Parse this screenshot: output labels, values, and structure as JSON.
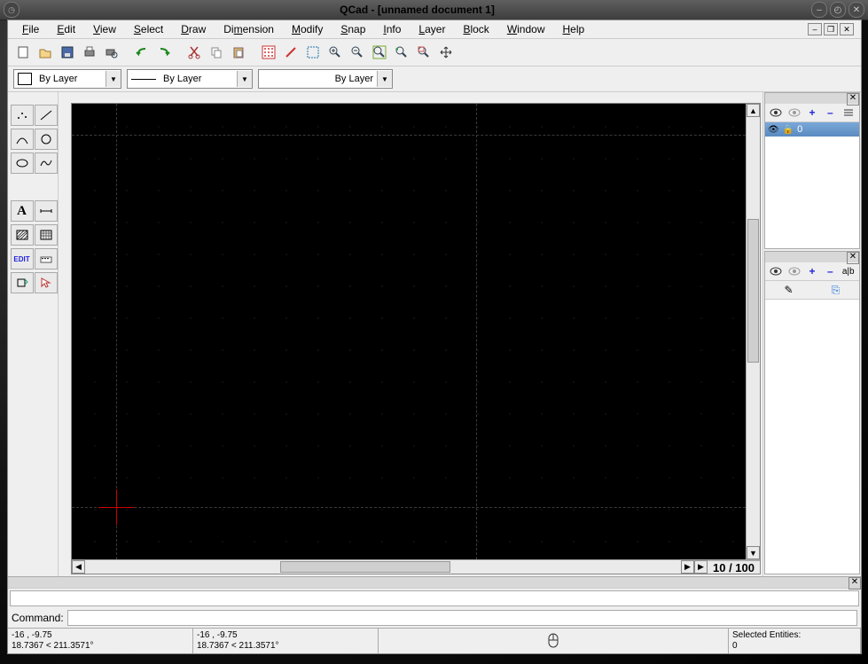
{
  "title": "QCad - [unnamed document 1]",
  "menus": {
    "file": {
      "label": "File",
      "u": "F"
    },
    "edit": {
      "label": "Edit",
      "u": "E"
    },
    "view": {
      "label": "View",
      "u": "V"
    },
    "select": {
      "label": "Select",
      "u": "s"
    },
    "draw": {
      "label": "Draw",
      "u": "D"
    },
    "dimension": {
      "label": "Dimension",
      "u": "D"
    },
    "modify": {
      "label": "Modify",
      "u": "M"
    },
    "snap": {
      "label": "Snap",
      "u": "S"
    },
    "info": {
      "label": "Info",
      "u": "I"
    },
    "layer": {
      "label": "Layer",
      "u": "L"
    },
    "block": {
      "label": "Block",
      "u": "B"
    },
    "window": {
      "label": "Window",
      "u": "W"
    },
    "help": {
      "label": "Help",
      "u": "H"
    }
  },
  "combos": {
    "color": "By Layer",
    "width": "By Layer",
    "linetype": "By Layer"
  },
  "zoom_label": "10 / 100",
  "layer": {
    "name": "0"
  },
  "command": {
    "label": "Command:",
    "value": ""
  },
  "status": {
    "coord1_a": "-16 , -9.75",
    "coord1_b": "18.7367 < 211.3571°",
    "coord2_a": "-16 , -9.75",
    "coord2_b": "18.7367 < 211.3571°",
    "sel_label": "Selected Entities:",
    "sel_count": "0"
  },
  "tooltxt": {
    "edit": "EDIT",
    "text": "A"
  },
  "panel": {
    "plus": "+",
    "minus": "–",
    "block_pen": "✎",
    "block_insert": "⎘"
  }
}
